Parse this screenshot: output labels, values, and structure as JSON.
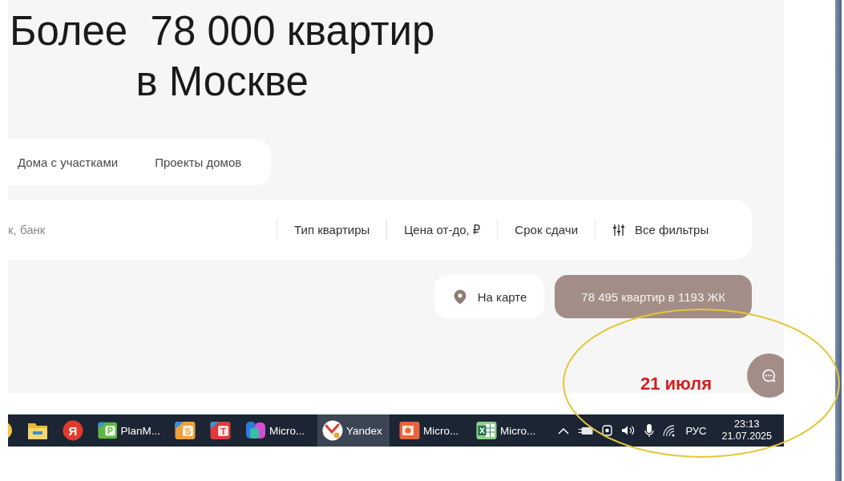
{
  "hero": {
    "title_lines": [
      "Более  78 000 квартир",
      "в Москве"
    ]
  },
  "property_tabs": [
    {
      "label": "Дома с участками",
      "selected": false
    },
    {
      "label": "Проекты домов",
      "selected": false
    }
  ],
  "search": {
    "placeholder": "к, банк",
    "filters": [
      {
        "label": "Тип квартиры",
        "kind": "dropdown"
      },
      {
        "label": "Цена от-до, ₽",
        "kind": "dropdown"
      },
      {
        "label": "Срок сдачи",
        "kind": "dropdown"
      },
      {
        "label": "Все фильтры",
        "kind": "all_filters"
      }
    ]
  },
  "actions": [
    {
      "label": "На карте",
      "kind": "map"
    },
    {
      "label": "78 495 квартир в 1193 ЖК",
      "kind": "primary"
    }
  ],
  "annotation": {
    "text": "21 июля"
  },
  "taskbar": {
    "apps": [
      {
        "kind": "cut_circle",
        "selected": false
      },
      {
        "kind": "folder",
        "selected": false
      },
      {
        "kind": "letter_circle",
        "glyph": "Я",
        "selected": false
      },
      {
        "kind": "tile_green",
        "glyph": "P",
        "label": "PlanM...",
        "selected": false
      },
      {
        "kind": "tile_orange",
        "glyph": "S",
        "selected": false
      },
      {
        "kind": "tile_red",
        "glyph": "T",
        "selected": false
      },
      {
        "kind": "blob",
        "label": "Micro...",
        "selected": false
      },
      {
        "kind": "browser",
        "label": "Yandex",
        "selected": true
      },
      {
        "kind": "slides",
        "label": "Micro...",
        "selected": false
      },
      {
        "kind": "sheet",
        "label": "Micro...",
        "selected": false
      }
    ],
    "tray": {
      "language": "РУС",
      "time": "23:13",
      "date": "21.07.2025"
    }
  }
}
